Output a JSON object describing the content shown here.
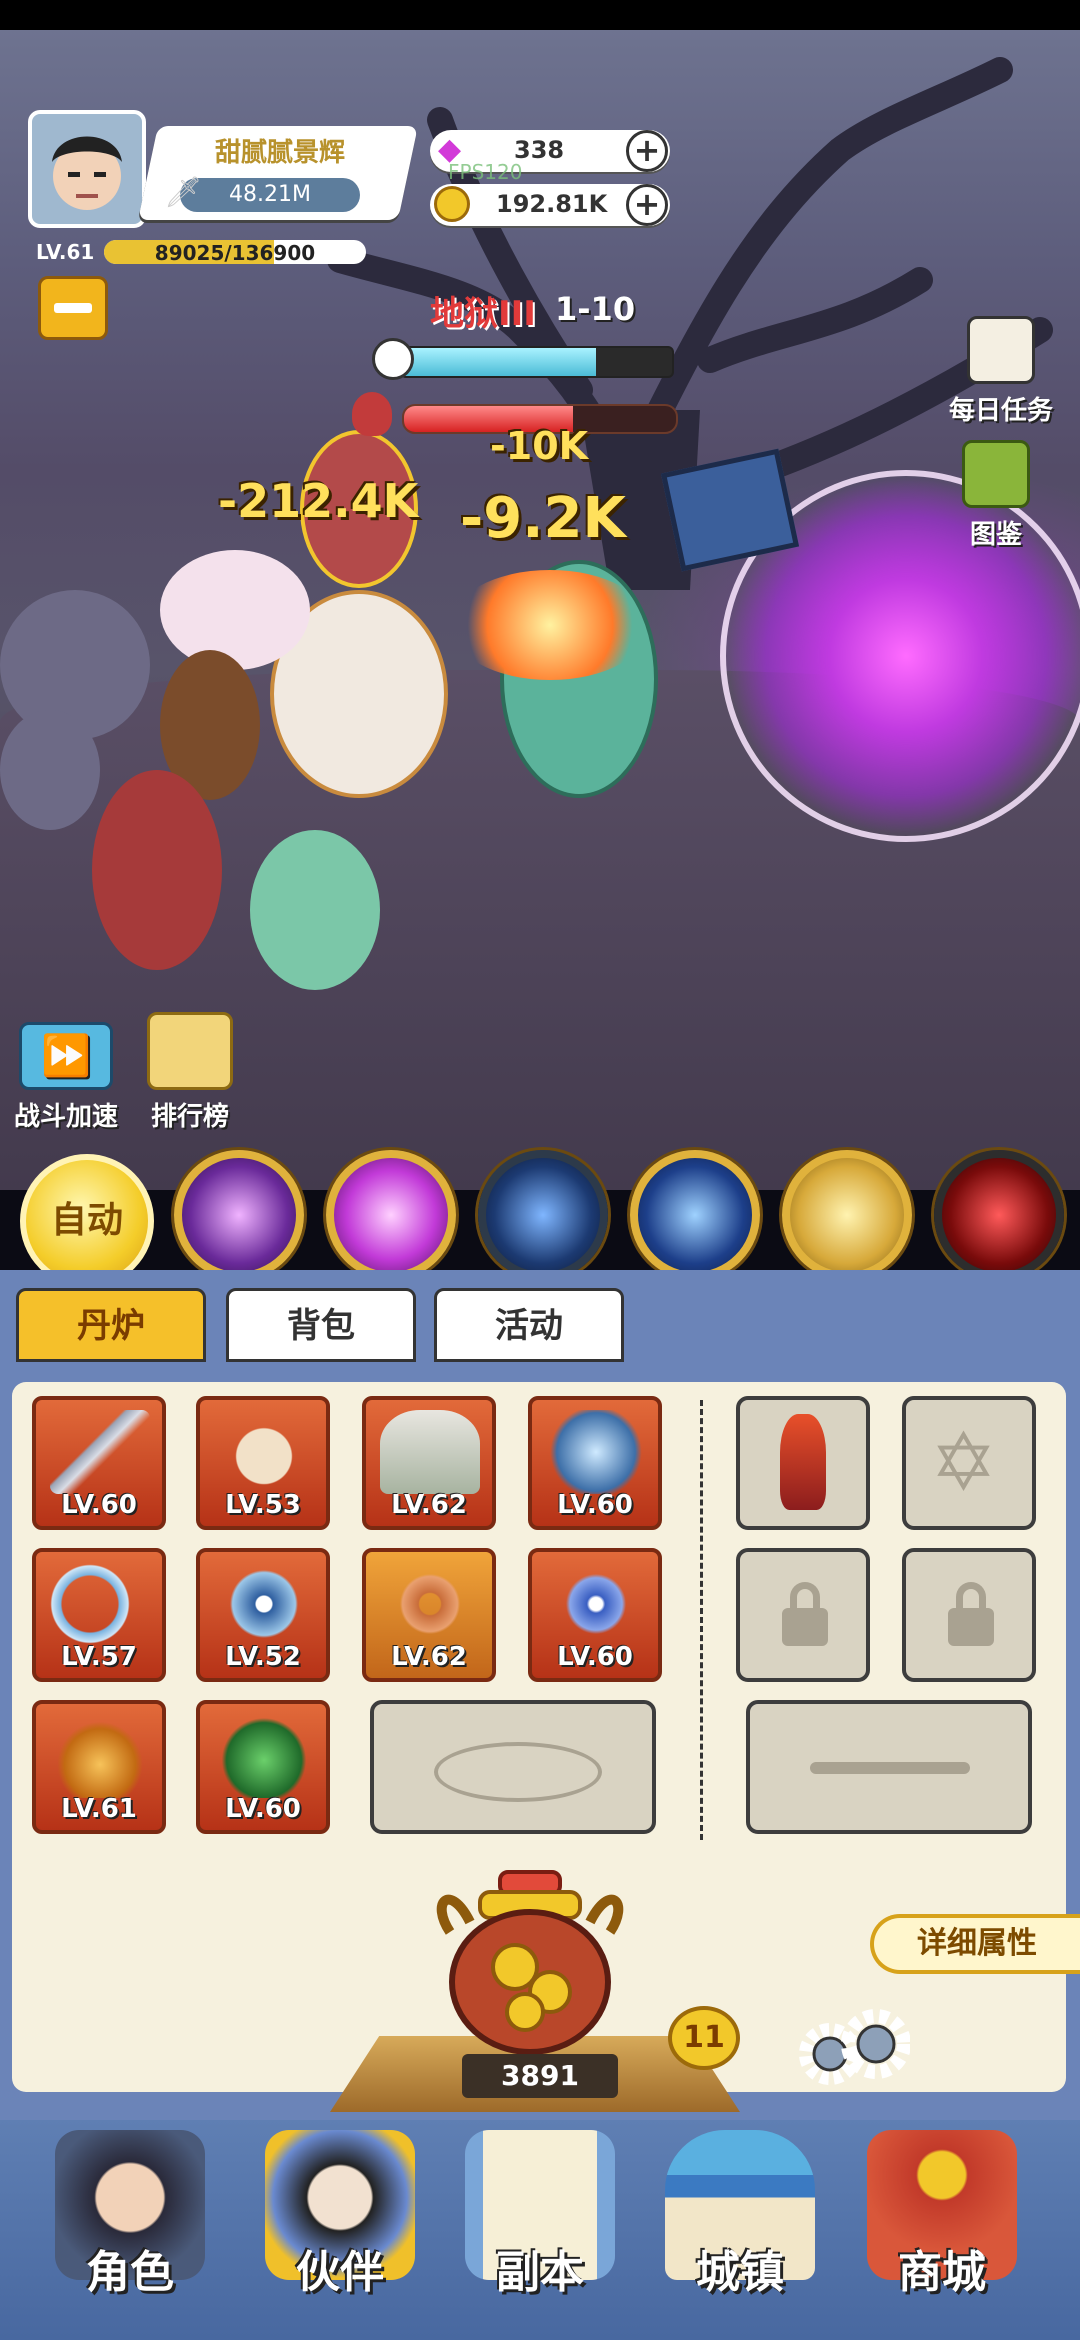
{
  "player": {
    "name": "甜腻腻景辉",
    "power": "48.21M",
    "level": "LV.61",
    "exp_text": "89025/136900",
    "exp_progress": 0.65
  },
  "currency": {
    "gems": "338",
    "coins": "192.81K",
    "overlay_text": "FPS120"
  },
  "stage": {
    "name": "地狱III",
    "number": "1-10",
    "timer_progress": 0.72,
    "boss_hp_progress": 0.62
  },
  "damage_numbers": [
    "-212.4K",
    "-9.2K",
    "-10K"
  ],
  "side_menu": {
    "daily_tasks": "每日任务",
    "codex": "图鉴",
    "battle_speed": "战斗加速",
    "leaderboard": "排行榜"
  },
  "skills": {
    "auto_label": "自动",
    "icons": [
      "purple-vortex-skill",
      "pink-spiral-skill",
      "blue-comet-skill",
      "lightning-rune-skill",
      "golden-lion-skill",
      "red-slash-skill"
    ]
  },
  "tabs": [
    "丹炉",
    "背包",
    "活动"
  ],
  "equipment": [
    {
      "icon": "dagger-icon",
      "level": "LV.60"
    },
    {
      "icon": "beast-mask-icon",
      "level": "LV.53"
    },
    {
      "icon": "sage-robe-icon",
      "level": "LV.62"
    },
    {
      "icon": "dragon-orb-icon",
      "level": "LV.60"
    },
    {
      "icon": "crescent-blade-icon",
      "level": "LV.57"
    },
    {
      "icon": "bagua-icon",
      "level": "LV.52"
    },
    {
      "icon": "jade-ring-icon",
      "level": "LV.62"
    },
    {
      "icon": "blue-amulet-icon",
      "level": "LV.60"
    },
    {
      "icon": "fire-helmet-icon",
      "level": "LV.61"
    },
    {
      "icon": "green-armor-icon",
      "level": "LV.60"
    }
  ],
  "detail_button": "详细属性",
  "furnace": {
    "count": "3891",
    "level_badge": "11"
  },
  "colors": {
    "accent_gold": "#f5c02a",
    "equip_red": "#c2401f",
    "panel_cream": "#f6f1de",
    "nav_blue": "#5a79ae"
  },
  "nav": [
    "角色",
    "伙伴",
    "副本",
    "城镇",
    "商城"
  ]
}
